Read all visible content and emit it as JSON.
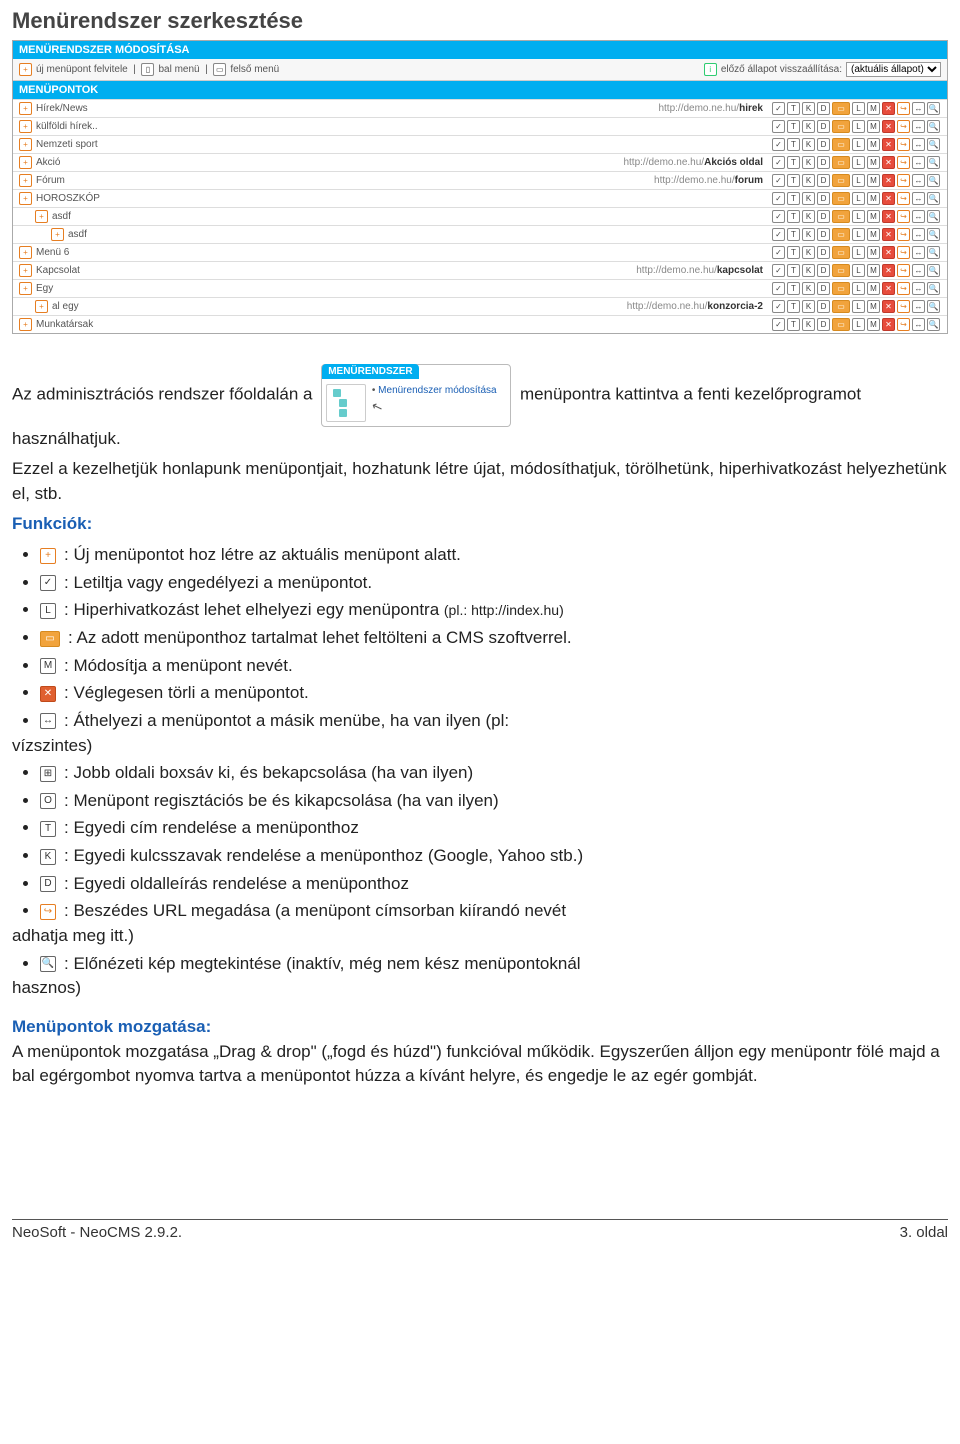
{
  "title": "Menürendszer szerkesztése",
  "panel": {
    "bar1": "MENÜRENDSZER MÓDOSÍTÁSA",
    "toolbar": {
      "new_menu": "új menüpont felvitele",
      "left_menu": "bal menü",
      "top_menu": "felső menü",
      "restore_label": "előző állapot visszaállítása:",
      "restore_value": "(aktuális állapot)"
    },
    "bar2": "MENÜPONTOK",
    "rows": [
      {
        "indent": 0,
        "name": "Hírek/News",
        "url_pre": "http://demo.ne.hu/",
        "url_bold": "hirek"
      },
      {
        "indent": 0,
        "name": "külföldi hírek..",
        "url_pre": "",
        "url_bold": ""
      },
      {
        "indent": 0,
        "name": "Nemzeti sport",
        "url_pre": "",
        "url_bold": ""
      },
      {
        "indent": 0,
        "name": "Akció",
        "url_pre": "http://demo.ne.hu/",
        "url_bold": "Akciós oldal"
      },
      {
        "indent": 0,
        "name": "Fórum",
        "url_pre": "http://demo.ne.hu/",
        "url_bold": "forum"
      },
      {
        "indent": 0,
        "name": "HOROSZKÓP",
        "url_pre": "",
        "url_bold": ""
      },
      {
        "indent": 1,
        "name": "asdf",
        "url_pre": "",
        "url_bold": ""
      },
      {
        "indent": 2,
        "name": "asdf",
        "url_pre": "",
        "url_bold": ""
      },
      {
        "indent": 0,
        "name": "Menü 6",
        "url_pre": "",
        "url_bold": ""
      },
      {
        "indent": 0,
        "name": "Kapcsolat",
        "url_pre": "http://demo.ne.hu/",
        "url_bold": "kapcsolat"
      },
      {
        "indent": 0,
        "name": "Egy",
        "url_pre": "",
        "url_bold": ""
      },
      {
        "indent": 1,
        "name": "al egy",
        "url_pre": "http://demo.ne.hu/",
        "url_bold": "konzorcia-2"
      },
      {
        "indent": 0,
        "name": "Munkatársak",
        "url_pre": "",
        "url_bold": ""
      }
    ]
  },
  "widget": {
    "title": "MENÜRENDSZER",
    "link_text": "Menürendszer módosítása"
  },
  "body": {
    "para1_pre": "Az adminisztrációs rendszer főoldalán a ",
    "para1_post": " menüpontra kattintva a fenti kezelőprogramot használhatjuk.",
    "para2": "Ezzel a kezelhetjük honlapunk menüpontjait, hozhatunk létre újat, módosíthatjuk, törölhetünk, hiperhivatkozást helyezhetünk el, stb.",
    "funcs_label": "Funkciók:",
    "funcs": [
      {
        "icon": "+",
        "cls": "orange-border",
        "text": ": Új menüpontot hoz létre az aktuális menüpont alatt."
      },
      {
        "icon": "✓",
        "cls": "",
        "text": ": Letiltja vagy engedélyezi a menüpontot."
      },
      {
        "icon": "L",
        "cls": "",
        "text_pre": ": Hiperhivatkozást lehet elhelyezi egy menüpontra ",
        "text_small": "(pl.: http://index.hu)"
      },
      {
        "icon": "▭",
        "cls": "orange-fill",
        "text": ": Az adott menüponthoz tartalmat lehet feltölteni a CMS szoftverrel."
      },
      {
        "icon": "M",
        "cls": "",
        "text": ": Módosítja a menüpont nevét."
      },
      {
        "icon": "✕",
        "cls": "red-fill",
        "text": ": Véglegesen törli a menüpontot."
      },
      {
        "icon": "↔",
        "cls": "",
        "text_pre": ": Áthelyezi a menüpontot a másik menübe, ha van ilyen (pl: ",
        "text_post": "vízszintes)"
      },
      {
        "icon": "⊞",
        "cls": "",
        "text": ": Jobb oldali boxsáv ki, és bekapcsolása (ha van ilyen)"
      },
      {
        "icon": "O",
        "cls": "",
        "text": ": Menüpont regisztációs be és kikapcsolása (ha van ilyen)"
      },
      {
        "icon": "T",
        "cls": "",
        "text": ": Egyedi cím rendelése a menüponthoz"
      },
      {
        "icon": "K",
        "cls": "",
        "text": ": Egyedi kulcsszavak rendelése a menüponthoz (Google, Yahoo stb.)"
      },
      {
        "icon": "D",
        "cls": "",
        "text": ": Egyedi oldalleírás rendelése a menüponthoz"
      },
      {
        "icon": "↪",
        "cls": "orange-border",
        "text_pre": ": Beszédes URL megadása (a menüpont címsorban kiírandó nevét ",
        "text_post": "adhatja meg itt.)"
      },
      {
        "icon": "🔍",
        "cls": "",
        "text_pre": ": Előnézeti kép megtekintése (inaktív, még nem kész menüpontoknál ",
        "text_post": "hasznos)"
      }
    ],
    "move_heading": "Menüpontok mozgatása:",
    "move_para": "A menüpontok mozgatása „Drag & drop\" („fogd és húzd\") funkcióval működik. Egyszerűen álljon egy menüpontr fölé majd a bal egérgombot nyomva tartva a menüpontot húzza a kívánt helyre, és engedje le az egér gombját."
  },
  "footer": {
    "left": "NeoSoft - NeoCMS 2.9.2.",
    "right": "3. oldal"
  },
  "icon_set": [
    "✓",
    "T",
    "K",
    "D",
    "▭",
    "L",
    "M",
    "✕",
    "↪",
    "↔",
    "🔍"
  ]
}
